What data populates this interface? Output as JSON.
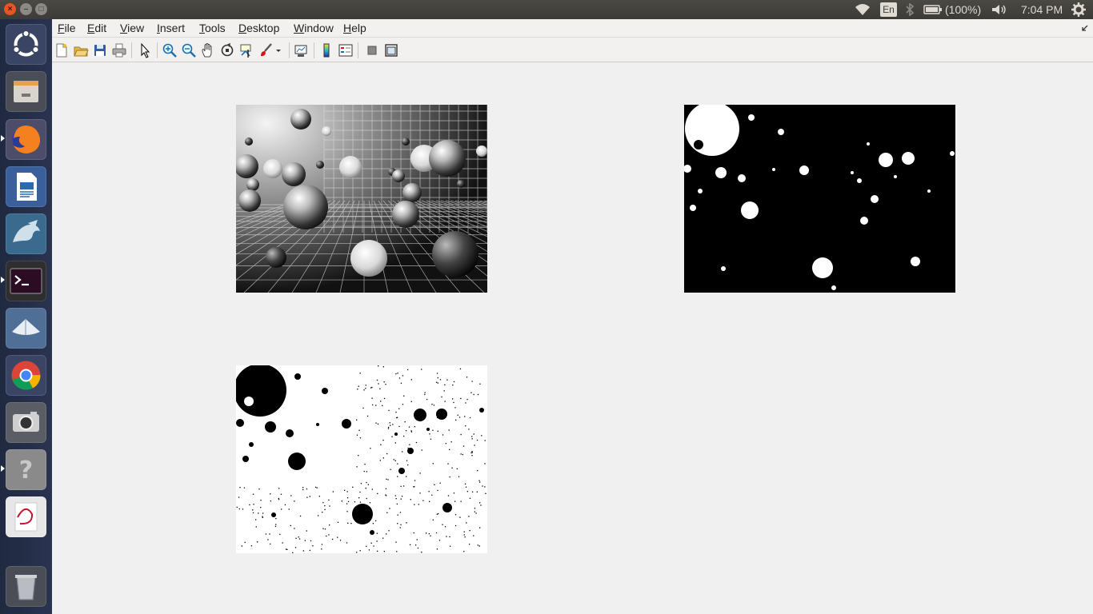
{
  "topbar": {
    "window_buttons": [
      "close-icon",
      "minimize-icon",
      "maximize-icon"
    ],
    "keyboard_layout": "En",
    "battery": "(100%)",
    "clock": "7:04 PM"
  },
  "launcher": {
    "items": [
      "ubuntu-dash",
      "files",
      "firefox",
      "libreoffice-writer",
      "mysql-workbench",
      "terminal",
      "shotwell",
      "google-chrome",
      "cheese-camera",
      "help",
      "evince",
      "trash"
    ]
  },
  "menubar": {
    "items": [
      "File",
      "Edit",
      "View",
      "Insert",
      "Tools",
      "Desktop",
      "Window",
      "Help"
    ]
  },
  "toolbar": {
    "buttons": [
      "new-figure-icon",
      "open-file-icon",
      "save-icon",
      "print-icon",
      "edit-plot-icon",
      "zoom-in-icon",
      "zoom-out-icon",
      "pan-icon",
      "rotate-3d-icon",
      "data-cursor-icon",
      "brush-icon",
      "link-plot-icon",
      "insert-colorbar-icon",
      "insert-legend-icon",
      "hide-plot-tools-icon",
      "show-plot-tools-icon"
    ]
  },
  "figure": {
    "subplots": [
      {
        "id": "original-grayscale",
        "kind": "grayscale image of spheres on grid"
      },
      {
        "id": "binary-threshold",
        "kind": "binary image, white blobs on black"
      },
      {
        "id": "binary-inverted",
        "kind": "binary image, black blobs on white"
      }
    ]
  },
  "colors": {
    "topbar": "#3c3b37",
    "launcher": "#27304a",
    "menubar": "#f2f1f0",
    "figure_background": "#f0f0f0",
    "accent": "#e95420"
  }
}
